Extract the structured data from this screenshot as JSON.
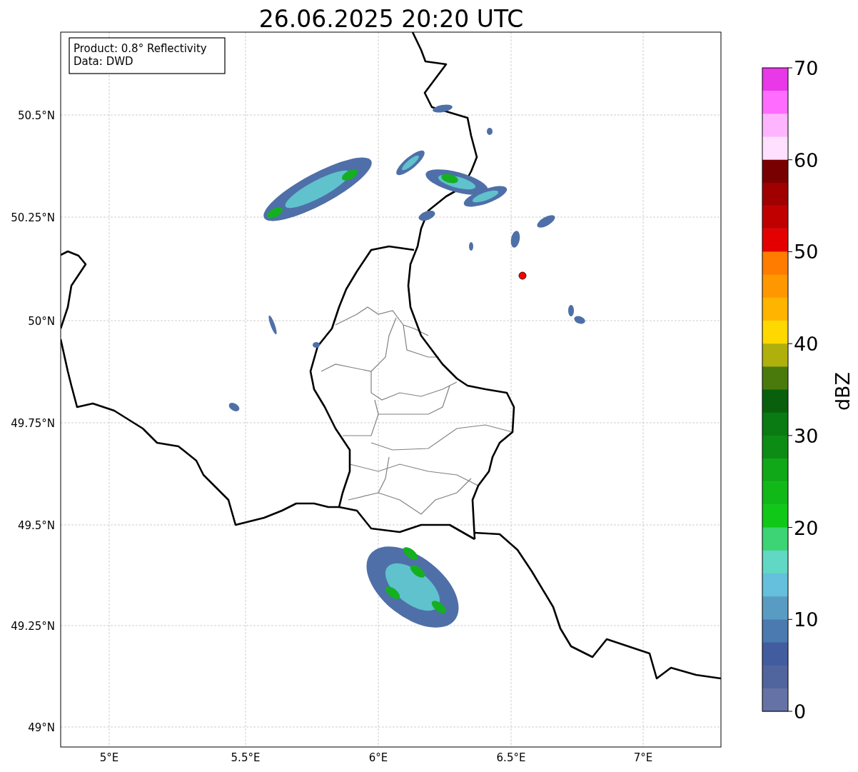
{
  "title": "26.06.2025 20:20 UTC",
  "legend": [
    "Product: 0.8° Reflectivity",
    "Data: DWD"
  ],
  "map": {
    "lon_labels": [
      "5°E",
      "5.5°E",
      "6°E",
      "6.5°E",
      "7°E"
    ],
    "lat_labels": [
      "50.5°N",
      "50.25°N",
      "50°N",
      "49.75°N",
      "49.5°N",
      "49.25°N",
      "49°N"
    ]
  },
  "colorbar": {
    "label": "dBZ",
    "ticks": [
      "70",
      "60",
      "50",
      "40",
      "30",
      "20",
      "10",
      "0"
    ],
    "bands": [
      {
        "color": "#e838e8"
      },
      {
        "color": "#ff6cff"
      },
      {
        "color": "#ffb4ff"
      },
      {
        "color": "#ffe0ff"
      },
      {
        "color": "#780000"
      },
      {
        "color": "#a00000"
      },
      {
        "color": "#c00000"
      },
      {
        "color": "#e40000"
      },
      {
        "color": "#ff7c00"
      },
      {
        "color": "#ff9800"
      },
      {
        "color": "#ffb400"
      },
      {
        "color": "#ffd800"
      },
      {
        "color": "#b0b00c"
      },
      {
        "color": "#4a7a0c"
      },
      {
        "color": "#08600c"
      },
      {
        "color": "#0a7a12"
      },
      {
        "color": "#0c8c14"
      },
      {
        "color": "#10a818"
      },
      {
        "color": "#10b818"
      },
      {
        "color": "#10c818"
      },
      {
        "color": "#3cd474"
      },
      {
        "color": "#60d8c4"
      },
      {
        "color": "#64c0dc"
      },
      {
        "color": "#589cc4"
      },
      {
        "color": "#4a7ab0"
      },
      {
        "color": "#425ca0"
      },
      {
        "color": "#50659e"
      },
      {
        "color": "#6472a6"
      }
    ]
  }
}
